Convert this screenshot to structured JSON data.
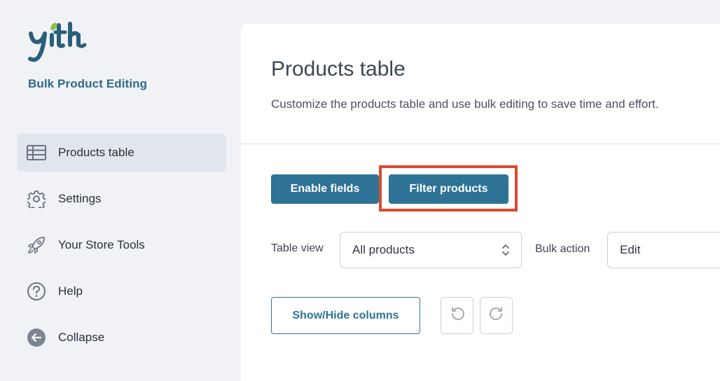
{
  "sidebar": {
    "logo_text": "yith",
    "plugin_name": "Bulk Product Editing",
    "items": [
      {
        "label": "Products table",
        "icon": "table-icon",
        "active": true
      },
      {
        "label": "Settings",
        "icon": "gear-icon",
        "active": false
      },
      {
        "label": "Your Store Tools",
        "icon": "rocket-icon",
        "active": false
      },
      {
        "label": "Help",
        "icon": "help-icon",
        "active": false
      },
      {
        "label": "Collapse",
        "icon": "collapse-arrow-icon",
        "active": false
      }
    ]
  },
  "main": {
    "title": "Products table",
    "description": "Customize the products table and use bulk editing to save time and effort.",
    "enable_fields_label": "Enable fields",
    "filter_products_label": "Filter products",
    "table_view_label": "Table view",
    "table_view_value": "All products",
    "bulk_action_label": "Bulk action",
    "bulk_action_value": "Edit",
    "show_hide_columns_label": "Show/Hide columns"
  },
  "colors": {
    "brand": "#2e7396",
    "highlight": "#d94a2e",
    "logo_leaf": "#8bc34a"
  }
}
